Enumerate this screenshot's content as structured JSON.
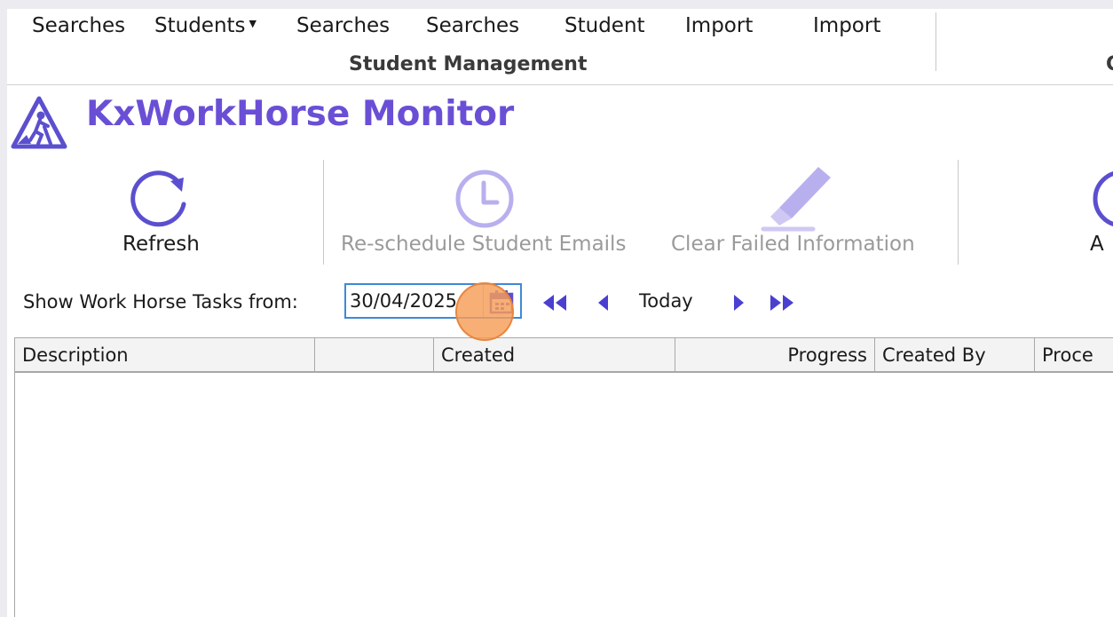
{
  "ribbon": {
    "items": [
      "Searches",
      "Students",
      "Searches",
      "Searches",
      "Student",
      "Import",
      "Import"
    ],
    "group_label": "Student Management",
    "right_group_label": "C"
  },
  "title": {
    "text": "KxWorkHorse Monitor",
    "icon": "workhorse-warning-icon"
  },
  "toolbar": {
    "refresh_label": "Refresh",
    "reschedule_label": "Re-schedule Student Emails",
    "clear_failed_label": "Clear Failed Information",
    "partial_label": "A"
  },
  "date_filter": {
    "label": "Show Work Horse Tasks from:",
    "value": "30/04/2025",
    "today_label": "Today"
  },
  "grid": {
    "columns": [
      "Description",
      "",
      "Created",
      "Progress",
      "Created By",
      "Proce"
    ],
    "rows": []
  },
  "colors": {
    "title_purple": "#6a4fd6",
    "icon_purple": "#5b4fcf",
    "disabled_icon": "#b8b0ee",
    "nav_blue": "#4a3fd0",
    "date_border": "#3d8ad6",
    "click_marker": "#f79e58"
  }
}
